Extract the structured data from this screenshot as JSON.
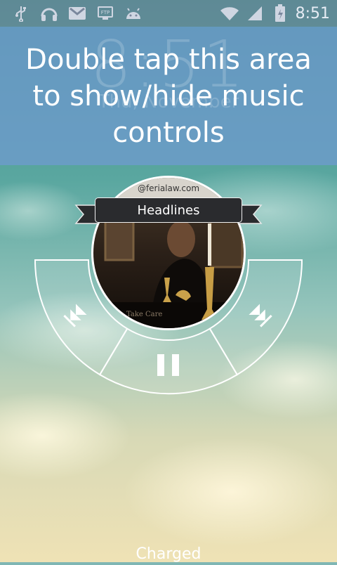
{
  "status_bar": {
    "time": "8:51",
    "left_icons": [
      "usb-icon",
      "headphones-icon",
      "gmail-icon",
      "ftp-icon",
      "android-icon"
    ],
    "right_icons": [
      "wifi-icon",
      "signal-icon",
      "battery-icon"
    ]
  },
  "overlay": {
    "hint": "Double tap this area to show/hide music controls",
    "clock_ghost": "8:51",
    "date_ghost": "Thu, November"
  },
  "music": {
    "track_title": "Headlines",
    "art_watermark": "@ferialaw.com",
    "controls": [
      "previous-track-icon",
      "pause-icon",
      "next-track-icon"
    ]
  },
  "footer": {
    "status": "Charged"
  },
  "colors": {
    "overlay": "#6e9bcd",
    "label_bg": "#2a2b2e",
    "wedge_fill": "rgba(255,255,255,0.12)"
  }
}
